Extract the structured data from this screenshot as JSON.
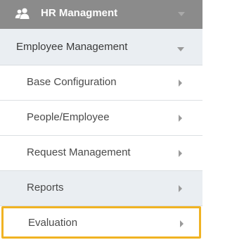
{
  "header": {
    "title": "HR Managment",
    "icon": "people-icon",
    "caret_icon": "caret-down-icon"
  },
  "section": {
    "label": "Employee Management",
    "caret_icon": "caret-down-icon"
  },
  "items": [
    {
      "label": "Base Configuration",
      "icon": "chevron-right-icon"
    },
    {
      "label": "People/Employee",
      "icon": "chevron-right-icon"
    },
    {
      "label": "Request Management",
      "icon": "chevron-right-icon"
    },
    {
      "label": "Reports",
      "icon": "chevron-right-icon"
    },
    {
      "label": "Evaluation",
      "icon": "chevron-right-icon"
    }
  ],
  "colors": {
    "header_bg": "#8b8b8b",
    "section_bg": "#eaeef2",
    "highlight_border": "#f0b323"
  }
}
